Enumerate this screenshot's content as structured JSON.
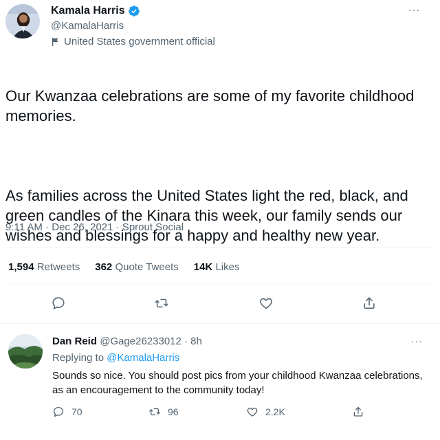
{
  "main_tweet": {
    "display_name": "Kamala Harris",
    "handle": "@KamalaHarris",
    "gov_label": "United States government official",
    "text_p1": "Our Kwanzaa celebrations are some of my favorite childhood memories.",
    "text_p2": "As families across the United States light the red, black, and green candles of the Kinara this week, our family sends our wishes and blessings for a happy and healthy new year.",
    "meta": "9:11 AM · Dec 26, 2021 · Sprout Social",
    "stats": {
      "retweets_num": "1,594",
      "retweets_label": "Retweets",
      "quotes_num": "362",
      "quotes_label": "Quote Tweets",
      "likes_num": "14K",
      "likes_label": "Likes"
    },
    "more_label": "···"
  },
  "reply": {
    "display_name": "Dan Reid",
    "handle_time": "@Gage26233012 · 8h",
    "replying_prefix": "Replying to",
    "replying_to": "@KamalaHarris",
    "text": "Sounds so nice.  You should post pics from your childhood Kwanzaa celebrations, as an encouragement to the community today!",
    "replies": "70",
    "retweets": "96",
    "likes": "2.2K",
    "more_label": "···"
  },
  "colors": {
    "accent": "#1d9bf0",
    "secondary_text": "#536471",
    "divider": "#eff3f4"
  },
  "icons": [
    "verified-badge-icon",
    "flag-icon",
    "more-icon",
    "reply-icon",
    "retweet-icon",
    "like-icon",
    "share-icon"
  ]
}
